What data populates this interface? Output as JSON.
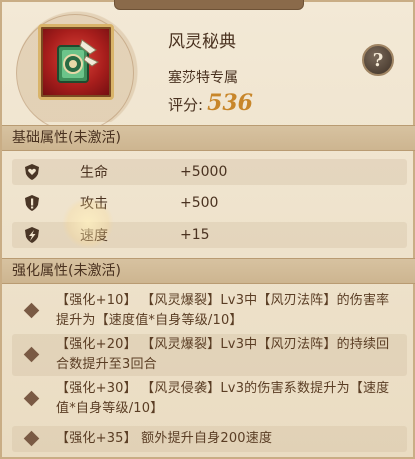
{
  "item": {
    "name": "风灵秘典",
    "owner": "塞莎特专属",
    "score_label": "评分:",
    "score_value": "536",
    "icon": "wind-spirit-tome-icon"
  },
  "help": {
    "label": "?",
    "icon": "question-mark-icon"
  },
  "basic": {
    "title": "基础属性(未激活)",
    "stats": [
      {
        "label": "生命",
        "value": "+5000",
        "icon": "heart-shield-icon"
      },
      {
        "label": "攻击",
        "value": "+500",
        "icon": "exclamation-shield-icon"
      },
      {
        "label": "速度",
        "value": "+15",
        "icon": "speed-shield-icon"
      }
    ]
  },
  "enhance": {
    "title": "强化属性(未激活)",
    "items": [
      {
        "text": "【强化+10】 【风灵爆裂】Lv3中【风刃法阵】的伤害率提升为【速度值*自身等级/10】"
      },
      {
        "text": "【强化+20】 【风灵爆裂】Lv3中【风刃法阵】的持续回合数提升至3回合"
      },
      {
        "text": "【强化+30】 【风灵侵袭】Lv3的伤害系数提升为【速度值*自身等级/10】"
      },
      {
        "text": "【强化+35】 额外提升自身200速度"
      }
    ]
  },
  "colors": {
    "accent": "#c8862a",
    "text": "#4a3220",
    "frame_gold": "#d9b46a",
    "item_red": "#a81e1c"
  }
}
